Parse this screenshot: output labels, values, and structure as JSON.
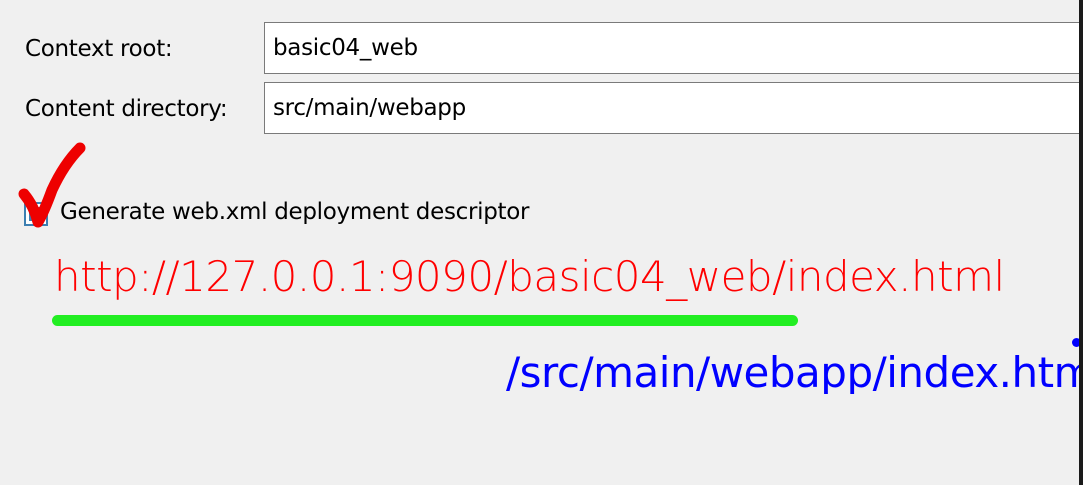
{
  "form": {
    "context_root_label": "Context root:",
    "context_root_value": "basic04_web",
    "content_directory_label": "Content directory:",
    "content_directory_value": "src/main/webapp",
    "generate_webxml_label": "Generate web.xml deployment descriptor",
    "generate_webxml_checked": true
  },
  "annotations": {
    "url_red": "http://127.0.0.1:9090/basic04_web/index.html",
    "url_blue": "/src/main/webapp/index.html",
    "colors": {
      "red_url": "#ff0000",
      "blue_url": "#0000ff",
      "underline": "#22ee22",
      "checkmark": "#ee0000",
      "checkbox_blue": "#3c7fb1"
    }
  }
}
